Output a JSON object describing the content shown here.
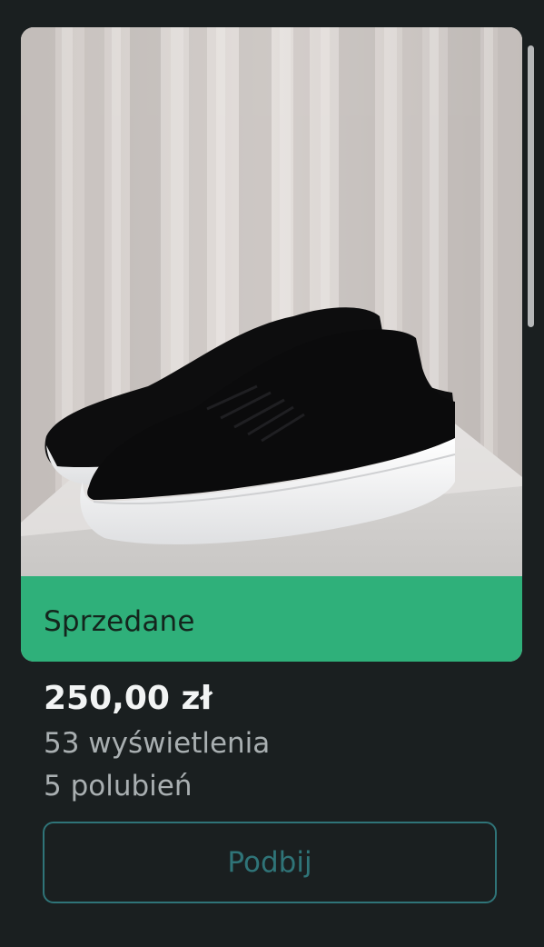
{
  "listing": {
    "status_label": "Sprzedane",
    "price": "250,00 zł",
    "views": "53 wyświetlenia",
    "likes": "5 polubień",
    "bump_label": "Podbij"
  },
  "colors": {
    "background": "#1a1f20",
    "status_bar": "#2fb07a",
    "button_accent": "#2f7478"
  }
}
